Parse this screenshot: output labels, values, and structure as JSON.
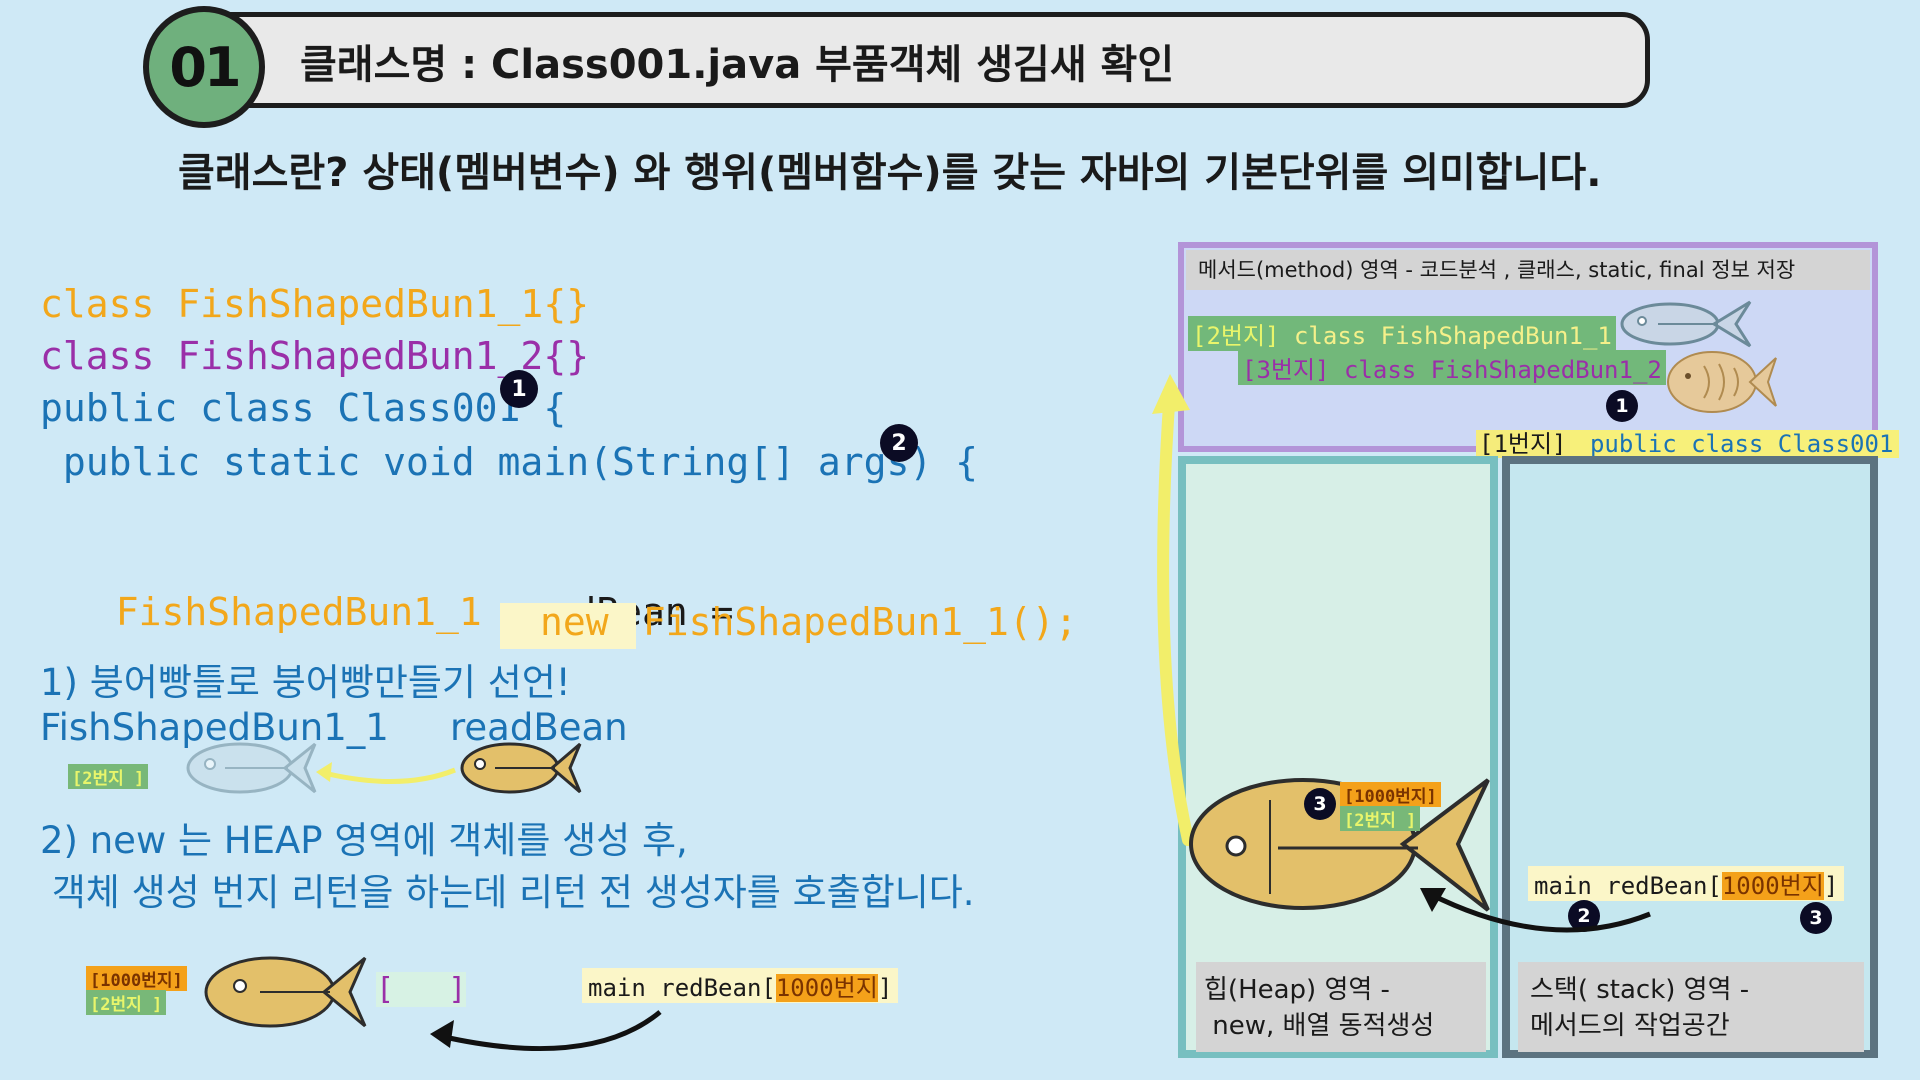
{
  "header": {
    "badge": "01",
    "title": "클래스명 : Class001.java     부품객체 생김새 확인",
    "subtitle": "클래스란? 상태(멤버변수) 와 행위(멤버함수)를 갖는 자바의 기본단위를 의미합니다."
  },
  "code": {
    "line1": "class FishShapedBun1_1{}",
    "line2": "class FishShapedBun1_2{}",
    "line3": "public class Class001 {",
    "line4": " public static void main(String[] args) {",
    "line5_type": "FishShapedBun1_1",
    "line5_rest": " readBean =",
    "line6_new": "new",
    "line6_rest": " FishShapedBun1_1();",
    "dot1": "1",
    "dot2": "2"
  },
  "notes": {
    "note1": "1) 붕어빵틀로 붕어빵만들기 선언!",
    "note1_type": "FishShapedBun1_1",
    "note1_var": "readBean",
    "note1_tag": "[2번지    ]",
    "note2_line1": "2) new 는 HEAP 영역에 객체를 생성 후,",
    "note2_line2": " 객체 생성 번지 리턴을 하는데 리턴 전 생성자를 호출합니다."
  },
  "bottom_left": {
    "tag_1000": "[1000번지]",
    "tag_2": "[2번지      ]",
    "bracket": "[   ]",
    "main_label": "main   redBean[",
    "addr": "1000번지",
    "close": "]"
  },
  "memory": {
    "method_header": "메서드(method) 영역   - 코드분석 , 클래스, static, final 정보 저장",
    "row2_addr": "[2번지]",
    "row2_text": "  class   FishShapedBun1_1",
    "row3_addr": "[3번지]",
    "row3_text": "  class   FishShapedBun1_2",
    "row1_addr": "[1번지]",
    "row1_text": "  public class    Class001",
    "dot1": "1",
    "heap_tag_1000": "[1000번지]",
    "heap_tag_2": "[2번지      ]",
    "heap_dot": "3",
    "stack_main": "main   redBean[",
    "stack_addr": "1000번지",
    "stack_close": "]",
    "stack_dot2": "2",
    "stack_dot3": "3",
    "heap_footer": "힙(Heap) 영역 -\n new, 배열 동적생성",
    "stack_footer": "스택( stack) 영역 -\n메서드의 작업공간"
  }
}
